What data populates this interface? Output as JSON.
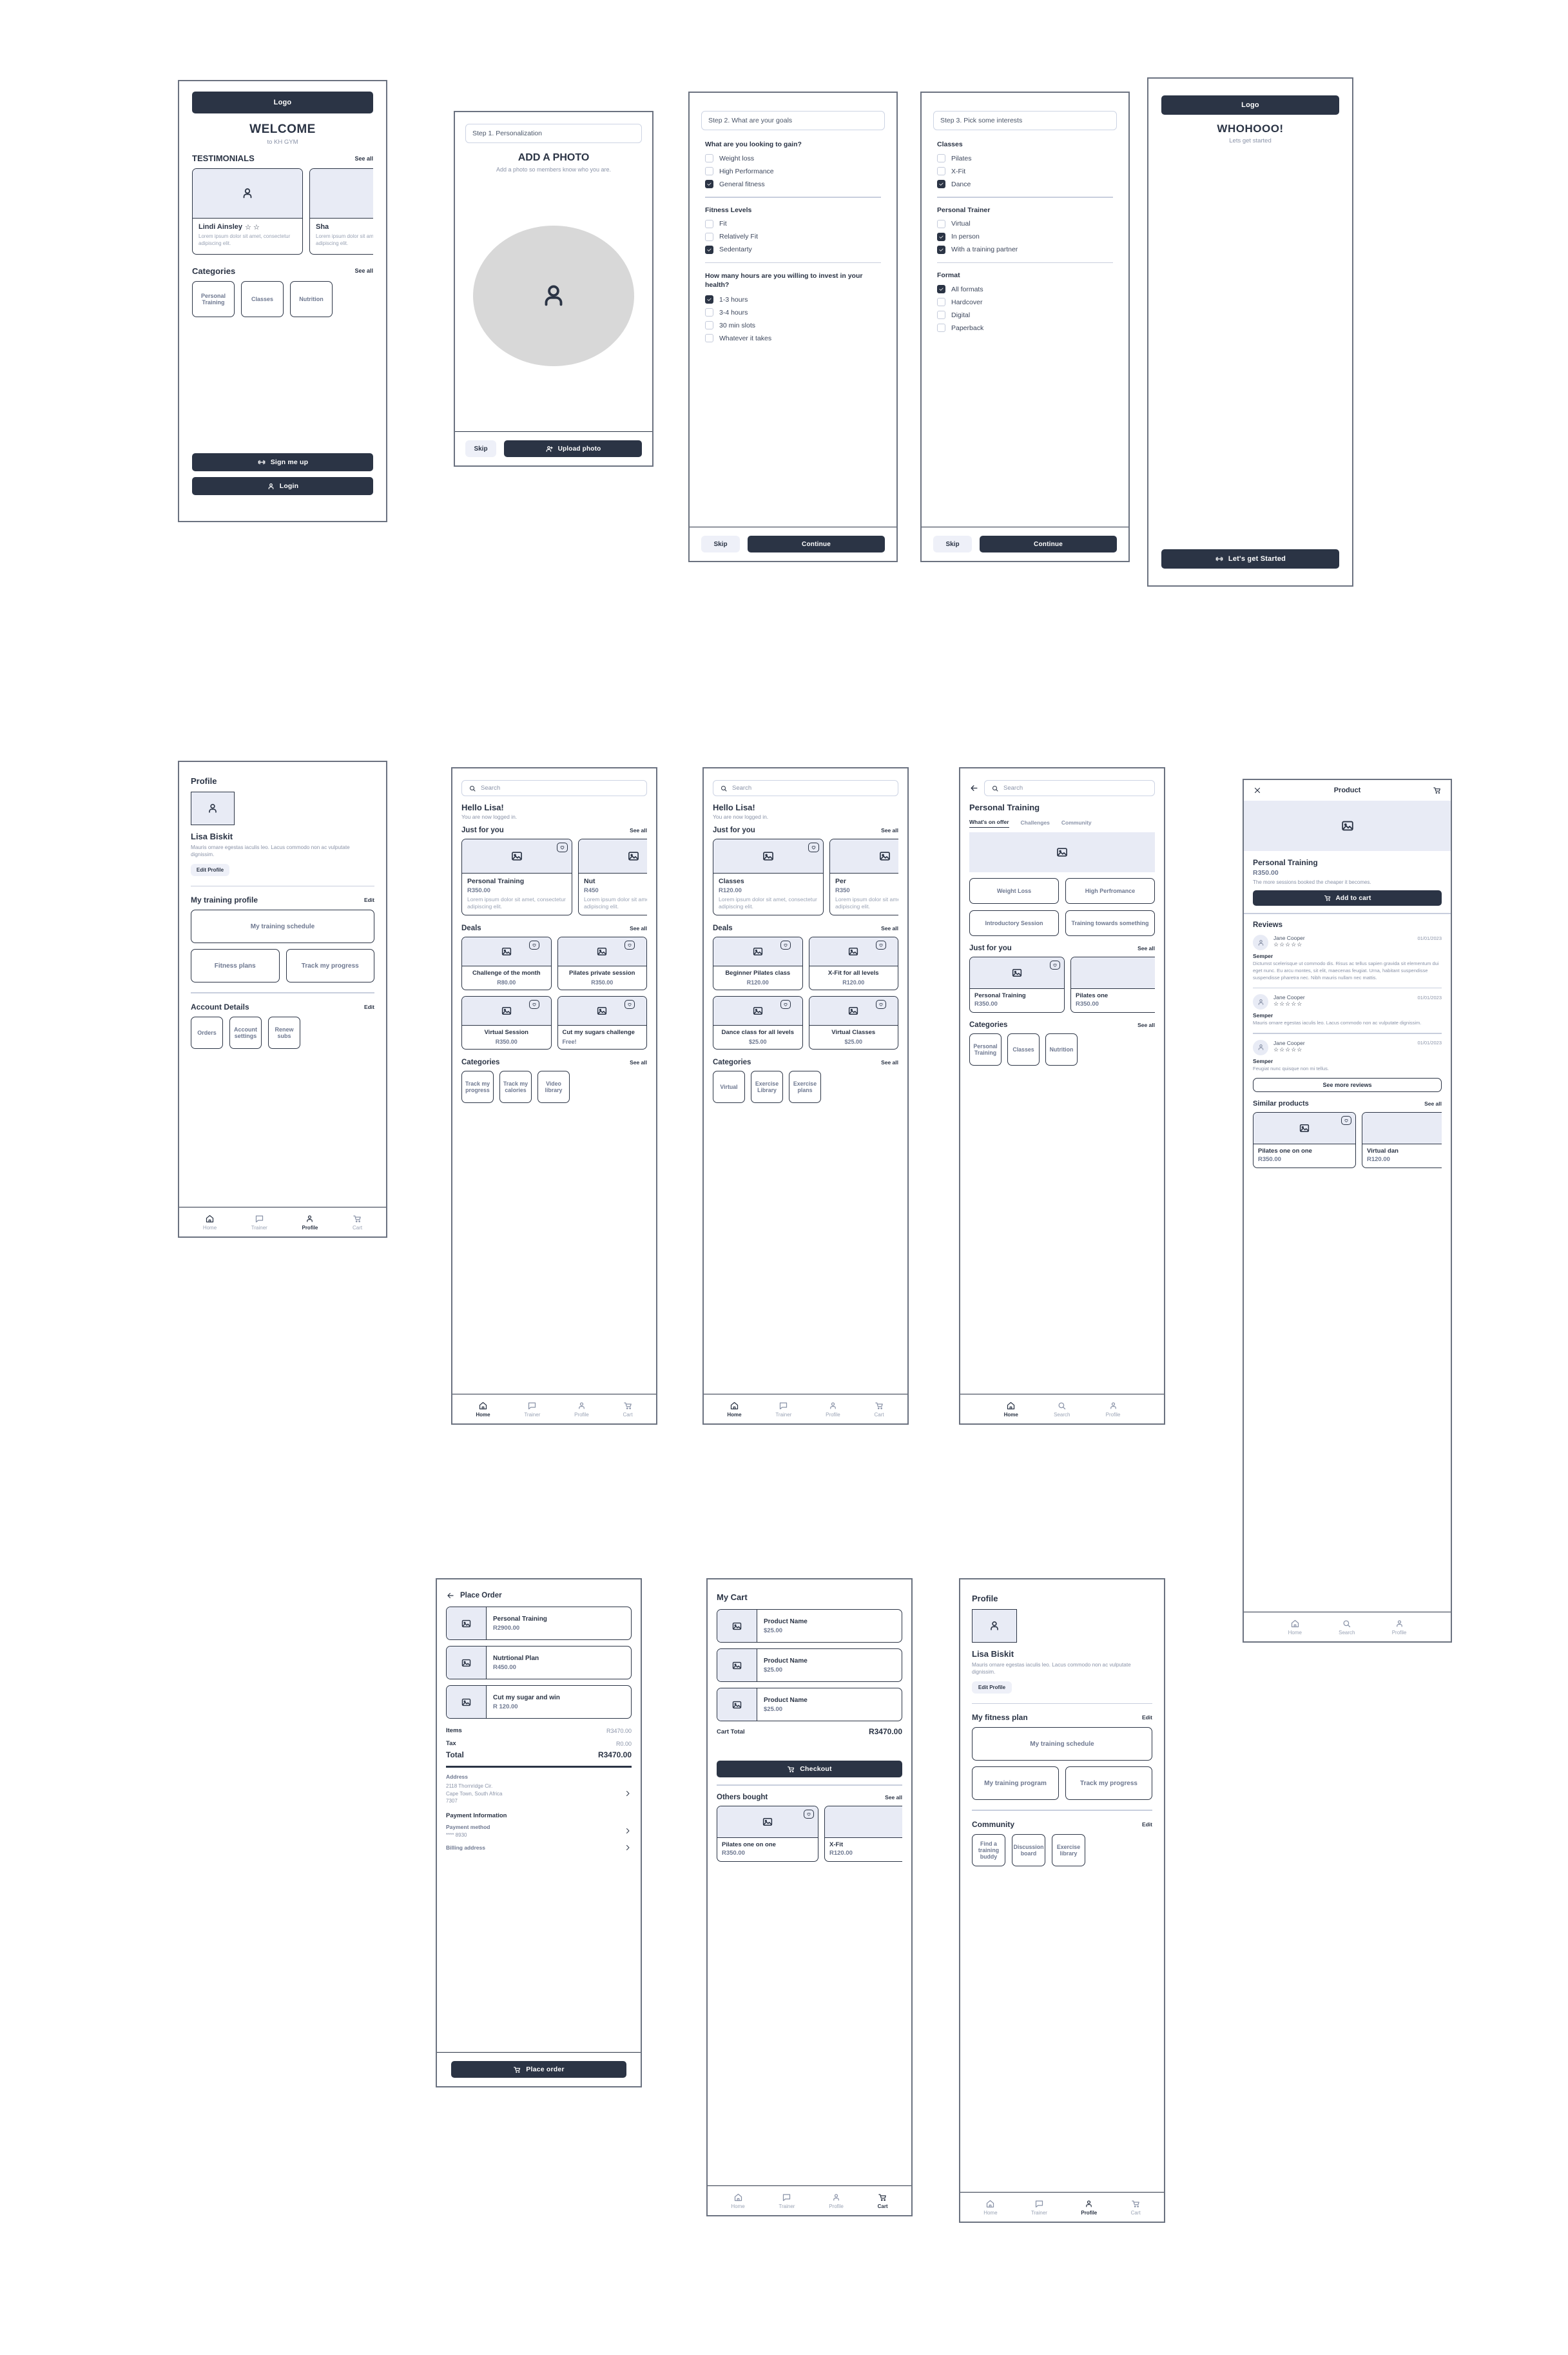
{
  "brand": {
    "dark": "#2b3445",
    "light_panel": "#e8ebf5",
    "muted": "#8a93a8"
  },
  "nav": {
    "home": "Home",
    "trainer": "Trainer",
    "profile": "Profile",
    "cart": "Cart",
    "search": "Search"
  },
  "welcome": {
    "logo": "Logo",
    "title": "WELCOME",
    "subtitle": "to KH GYM",
    "testimonials_title": "TESTIMONIALS",
    "see_all": "See all",
    "testimonials": [
      {
        "name": "Lindi Ainsley",
        "stars": "☆ ☆",
        "text": "Lorem ipsum dolor sit amet, consectetur adipiscing elit."
      },
      {
        "name": "Sha",
        "stars": "",
        "text": "Lorem ipsum dolor sit amet, consectetur adipiscing elit."
      }
    ],
    "categories_title": "Categories",
    "categories": [
      "Personal Training",
      "Classes",
      "Nutrition"
    ],
    "signup_label": "Sign me up",
    "login_label": "Login"
  },
  "step1": {
    "step_label": "Step  1. Personalization",
    "title": "ADD A PHOTO",
    "subtitle": "Add a photo so members know who you are.",
    "skip": "Skip",
    "primary": "Upload photo"
  },
  "step2": {
    "step_label": "Step  2. What are your goals",
    "groups": [
      {
        "title": "What are you looking to gain?",
        "options": [
          {
            "label": "Weight loss",
            "checked": false
          },
          {
            "label": "High Performance",
            "checked": false
          },
          {
            "label": "General fitness",
            "checked": true
          }
        ]
      },
      {
        "title": "Fitness Levels",
        "options": [
          {
            "label": "Fit",
            "checked": false
          },
          {
            "label": "Relatively Fit",
            "checked": false
          },
          {
            "label": "Sedentarty",
            "checked": true
          }
        ]
      },
      {
        "title": "How many hours are you willing to invest in your health?",
        "options": [
          {
            "label": "1-3 hours",
            "checked": true
          },
          {
            "label": "3-4 hours",
            "checked": false
          },
          {
            "label": "30 min slots",
            "checked": false
          },
          {
            "label": "Whatever it takes",
            "checked": false
          }
        ]
      }
    ],
    "skip": "Skip",
    "primary": "Continue"
  },
  "step3": {
    "step_label": "Step 3. Pick some interests",
    "groups": [
      {
        "title": "Classes",
        "options": [
          {
            "label": "Pilates",
            "checked": false
          },
          {
            "label": "X-Fit",
            "checked": false
          },
          {
            "label": "Dance",
            "checked": true
          }
        ]
      },
      {
        "title": "Personal Trainer",
        "options": [
          {
            "label": "Virtual",
            "checked": false
          },
          {
            "label": "In person",
            "checked": true
          },
          {
            "label": "With a training partner",
            "checked": true
          }
        ]
      },
      {
        "title": "Format",
        "options": [
          {
            "label": "All formats",
            "checked": true
          },
          {
            "label": "Hardcover",
            "checked": false
          },
          {
            "label": "Digital",
            "checked": false
          },
          {
            "label": "Paperback",
            "checked": false
          }
        ]
      }
    ],
    "skip": "Skip",
    "primary": "Continue"
  },
  "success": {
    "logo": "Logo",
    "title": "WHOHOOO!",
    "subtitle": "Lets get started",
    "cta": "Let's get Started"
  },
  "profile_a": {
    "title": "Profile",
    "name": "Lisa  Biskit",
    "bio": "Mauris ornare egestas iaculis leo. Lacus commodo non ac vulputate dignissim.",
    "edit_profile": "Edit Profile",
    "section1_title": "My training profile",
    "edit": "Edit",
    "schedule": "My training schedule",
    "tiles1": [
      "Fitness plans",
      "Track my progress"
    ],
    "section2_title": "Account Details",
    "tiles2": [
      "Orders",
      "Account settings",
      "Renew subs"
    ]
  },
  "home_a": {
    "search_placeholder": "Search",
    "greeting": "Hello Lisa!",
    "sub": "You are now logged in.",
    "just_for_you_title": "Just for you",
    "see_all": "See all",
    "just_for_you": [
      {
        "name": "Personal Training",
        "price": "R350.00",
        "desc": "Lorem ipsum dolor sit amet, consectetur adipiscing elit."
      },
      {
        "name": "Nut",
        "price": "R450",
        "desc": "Lorem ipsum dolor sit amet, consectetur adipiscing elit."
      }
    ],
    "deals_title": "Deals",
    "deals": [
      {
        "name": "Challenge of the month",
        "price": "R80.00"
      },
      {
        "name": "Pilates private session",
        "price": "R350.00"
      },
      {
        "name": "Virtual Session",
        "price": "R350.00"
      },
      {
        "name": "Cut my sugars challenge",
        "price": "Free!"
      }
    ],
    "categories_title": "Categories",
    "categories": [
      "Track my progress",
      "Track my calories",
      "Video library"
    ]
  },
  "home_b": {
    "search_placeholder": "Search",
    "greeting": "Hello Lisa!",
    "sub": "You are now logged in.",
    "just_for_you_title": "Just for you",
    "see_all": "See all",
    "just_for_you": [
      {
        "name": "Classes",
        "price": "R120.00",
        "desc": "Lorem ipsum dolor sit amet, consectetur adipiscing elit."
      },
      {
        "name": "Per",
        "price": "R350",
        "desc": "Lorem ipsum dolor sit amet, consectetur adipiscing elit."
      }
    ],
    "deals_title": "Deals",
    "deals": [
      {
        "name": "Beginner Pilates class",
        "price": "R120.00"
      },
      {
        "name": "X-Fit for all levels",
        "price": "R120.00"
      },
      {
        "name": "Dance class for all levels",
        "price": "$25.00"
      },
      {
        "name": "Virtual Classes",
        "price": "$25.00"
      }
    ],
    "categories_title": "Categories",
    "categories": [
      "Virtual",
      "Exercise Library",
      "Exercise plans"
    ]
  },
  "pt": {
    "search_placeholder": "Search",
    "title": "Personal Training",
    "tabs": [
      "What's on offer",
      "Challenges",
      "Community"
    ],
    "active_tab": "What's on offer",
    "tiles": [
      "Weight Loss",
      "High Perfromance",
      "Introductory Session",
      "Training towards something"
    ],
    "just_for_you_title": "Just for you",
    "see_all": "See all",
    "just_for_you": [
      {
        "name": "Personal Training",
        "price": "R350.00"
      },
      {
        "name": "Pilates one",
        "price": "R350.00"
      }
    ],
    "categories_title": "Categories",
    "categories": [
      "Personal Training",
      "Classes",
      "Nutrition"
    ]
  },
  "product": {
    "header_title": "Product",
    "name": "Personal Training",
    "price": "R350.00",
    "desc": "The more sessions booked the cheaper it becomes.",
    "add_to_cart": "Add to cart",
    "reviews_title": "Reviews",
    "reviews": [
      {
        "author": "Jane Cooper",
        "date": "01/01/2023",
        "stars": "☆☆☆☆☆",
        "headline": "Semper",
        "text": "Dictumst scelerisque ut commodo dis. Risus ac tellus sapien gravida sit elementum dui eget nunc. Eu arcu montes, sit elit, maecenas feugiat. Urna, habitant suspendisse suspendisse pharetra nec. Nibh mauris nullam nec mattis."
      },
      {
        "author": "Jane Cooper",
        "date": "01/01/2023",
        "stars": "☆☆☆☆☆",
        "headline": "Semper",
        "text": "Mauris ornare egestas iaculis leo. Lacus commodo non ac vulputate dignissim."
      },
      {
        "author": "Jane Cooper",
        "date": "01/01/2023",
        "stars": "☆☆☆☆☆",
        "headline": "Semper",
        "text": "Feugiat nunc quisque non mi tellus."
      }
    ],
    "see_more_reviews": "See more reviews",
    "similar_title": "Similar products",
    "see_all": "See all",
    "similar": [
      {
        "name": "Pilates one on one",
        "price": "R350.00"
      },
      {
        "name": "Virtual dan",
        "price": "R120.00"
      }
    ]
  },
  "order": {
    "title": "Place Order",
    "items": [
      {
        "name": "Personal Training",
        "price": "R2900.00"
      },
      {
        "name": "Nutrtional Plan",
        "price": "R450.00"
      },
      {
        "name": "Cut my sugar and win",
        "price": "R 120.00"
      }
    ],
    "items_label": "Items",
    "items_total": "R3470.00",
    "tax_label": "Tax",
    "tax_value": "R0.00",
    "total_label": "Total",
    "total_value": "R3470.00",
    "address_label": "Address",
    "address_lines": [
      "2118 Thornridge Cir.",
      "Cape Town, South Africa",
      "7307"
    ],
    "payment_title": "Payment Information",
    "payment_method_label": "Payment method",
    "payment_method_value": "**** 8930",
    "billing_label": "Billing address",
    "cta": "Place order"
  },
  "cart": {
    "title": "My Cart",
    "items": [
      {
        "name": "Product Name",
        "price": "$25.00"
      },
      {
        "name": "Product Name",
        "price": "$25.00"
      },
      {
        "name": "Product Name",
        "price": "$25.00"
      }
    ],
    "total_label": "Cart Total",
    "total_value": "R3470.00",
    "checkout": "Checkout",
    "others_title": "Others bought",
    "see_all": "See all",
    "others": [
      {
        "name": "Pilates one on one",
        "price": "R350.00"
      },
      {
        "name": "X-Fit",
        "price": "R120.00"
      }
    ]
  },
  "profile_b": {
    "title": "Profile",
    "name": "Lisa  Biskit",
    "bio": "Mauris ornare egestas iaculis leo. Lacus commodo non ac vulputate dignissim.",
    "edit_profile": "Edit Profile",
    "section1_title": "My  fitness plan",
    "edit": "Edit",
    "schedule": "My training schedule",
    "tiles1": [
      "My  training program",
      "Track my progress"
    ],
    "section2_title": "Community",
    "tiles2": [
      "Find a training buddy",
      "Discussion board",
      "Exercise library"
    ]
  }
}
